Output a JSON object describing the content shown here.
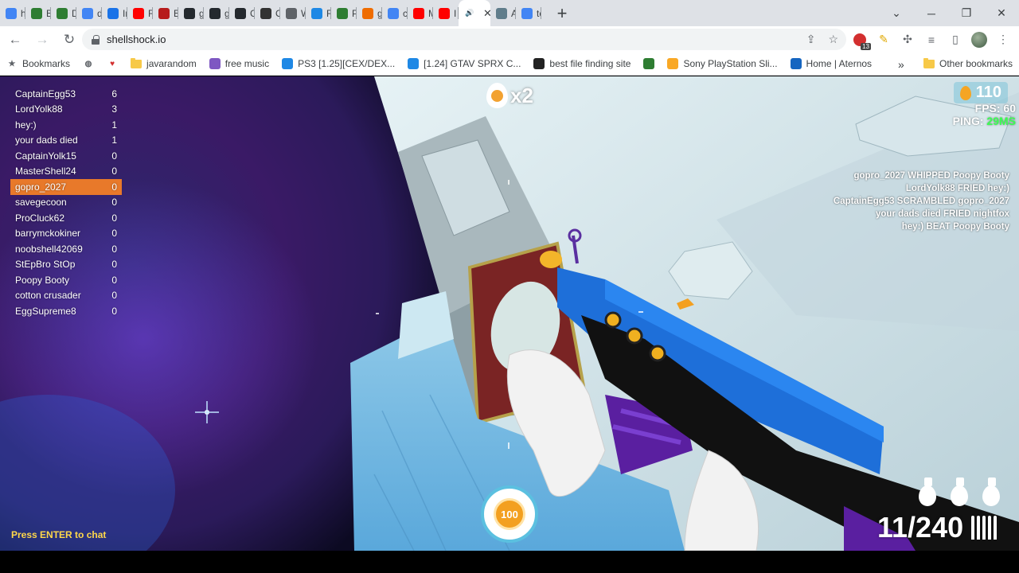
{
  "browser": {
    "tabs": [
      {
        "label": "hc",
        "icon": "google-icon",
        "color": "#4285f4",
        "active": false
      },
      {
        "label": "Bu",
        "icon": "green-app-icon",
        "color": "#2e7d32",
        "active": false
      },
      {
        "label": "Dc",
        "icon": "green-app-icon",
        "color": "#2e7d32",
        "active": false
      },
      {
        "label": "de",
        "icon": "google-icon",
        "color": "#4285f4",
        "active": false
      },
      {
        "label": "Im",
        "icon": "chart-icon",
        "color": "#1a73e8",
        "active": false
      },
      {
        "label": "Ru",
        "icon": "youtube-icon",
        "color": "#ff0000",
        "active": false
      },
      {
        "label": "Be",
        "icon": "medium-icon",
        "color": "#b71c1c",
        "active": false
      },
      {
        "label": "gc",
        "icon": "github-icon",
        "color": "#24292e",
        "active": false
      },
      {
        "label": "gc",
        "icon": "github-icon",
        "color": "#24292e",
        "active": false
      },
      {
        "label": "Cl",
        "icon": "github-icon",
        "color": "#24292e",
        "active": false
      },
      {
        "label": "Op",
        "icon": "openai-icon",
        "color": "#333333",
        "active": false
      },
      {
        "label": "W",
        "icon": "globe-icon",
        "color": "#5f6368",
        "active": false
      },
      {
        "label": "Re",
        "icon": "dot-icon",
        "color": "#1e88e5",
        "active": false
      },
      {
        "label": "Py",
        "icon": "w-icon",
        "color": "#2e7d32",
        "active": false
      },
      {
        "label": "gi",
        "icon": "swirl-icon",
        "color": "#ef6c00",
        "active": false
      },
      {
        "label": "ca",
        "icon": "google-icon",
        "color": "#4285f4",
        "active": false
      },
      {
        "label": "M",
        "icon": "youtube-icon",
        "color": "#ff0000",
        "active": false
      },
      {
        "label": "I t",
        "icon": "youtube-icon",
        "color": "#ff0000",
        "active": false
      },
      {
        "label": "",
        "icon": "speaker-icon",
        "color": "#3c4043",
        "active": true
      },
      {
        "label": "A",
        "icon": "image-icon",
        "color": "#607d8b",
        "active": false
      },
      {
        "label": "te",
        "icon": "google-icon",
        "color": "#4285f4",
        "active": false
      }
    ],
    "url": "shellshock.io",
    "extension_badge": "13",
    "bookmarks": [
      {
        "label": "Bookmarks",
        "icon": "star-icon",
        "color": "#5f6368"
      },
      {
        "label": "",
        "icon": "globe-icon",
        "color": "#5f6368"
      },
      {
        "label": "",
        "icon": "heart-icon",
        "color": "#d32f2f"
      },
      {
        "label": "javarandom",
        "icon": "folder-icon",
        "color": "#f7c948"
      },
      {
        "label": "free music",
        "icon": "alien-icon",
        "color": "#7e57c2"
      },
      {
        "label": "PS3 [1.25][CEX/DEX...",
        "icon": "c-icon",
        "color": "#1e88e5"
      },
      {
        "label": "[1.24] GTAV SPRX C...",
        "icon": "c-icon",
        "color": "#1e88e5"
      },
      {
        "label": "best file finding site",
        "icon": "tv-icon",
        "color": "#222222"
      },
      {
        "label": "",
        "icon": "app-icon",
        "color": "#2e7d32"
      },
      {
        "label": "Sony PlayStation Sli...",
        "icon": "bag-icon",
        "color": "#f9a825"
      },
      {
        "label": "Home | Aternos",
        "icon": "grid-icon",
        "color": "#1565c0"
      }
    ],
    "more_bookmarks": "»",
    "other_bookmarks": "Other bookmarks"
  },
  "game": {
    "scoreboard": [
      {
        "name": "CaptainEgg53",
        "score": "6",
        "self": false
      },
      {
        "name": "LordYolk88",
        "score": "3",
        "self": false
      },
      {
        "name": "hey:)",
        "score": "1",
        "self": false
      },
      {
        "name": "your dads died",
        "score": "1",
        "self": false
      },
      {
        "name": "CaptainYolk15",
        "score": "0",
        "self": false
      },
      {
        "name": "MasterShell24",
        "score": "0",
        "self": false
      },
      {
        "name": "gopro_2027",
        "score": "0",
        "self": true
      },
      {
        "name": "savegecoon",
        "score": "0",
        "self": false
      },
      {
        "name": "ProCluck62",
        "score": "0",
        "self": false
      },
      {
        "name": "barrymckokiner",
        "score": "0",
        "self": false
      },
      {
        "name": "noobshell42069",
        "score": "0",
        "self": false
      },
      {
        "name": "StEpBro StOp",
        "score": "0",
        "self": false
      },
      {
        "name": "Poopy Booty",
        "score": "0",
        "self": false
      },
      {
        "name": "cotton crusader",
        "score": "0",
        "self": false
      },
      {
        "name": "EggSupreme8",
        "score": "0",
        "self": false
      }
    ],
    "killfeed": [
      "gopro_2027 WHIPPED Poopy Booty",
      "LordYolk88 FRIED hey:)",
      "CaptainEgg53 SCRAMBLED gopro_2027",
      "your dads died FRIED nightfox",
      "hey:) BEAT Poopy Booty"
    ],
    "coins": "110",
    "fps_label": "FPS:",
    "fps": "60",
    "ping_label": "PING:",
    "ping": "29MS",
    "streak": "x2",
    "health": "100",
    "grenades": 3,
    "ammo": "11/240",
    "chat_hint": "Press ENTER to chat",
    "colors": {
      "self_highlight": "#e8792a",
      "ping": "#3bff52",
      "gun_blue": "#1e6fd9",
      "chat_hint": "#ffd84a"
    }
  }
}
